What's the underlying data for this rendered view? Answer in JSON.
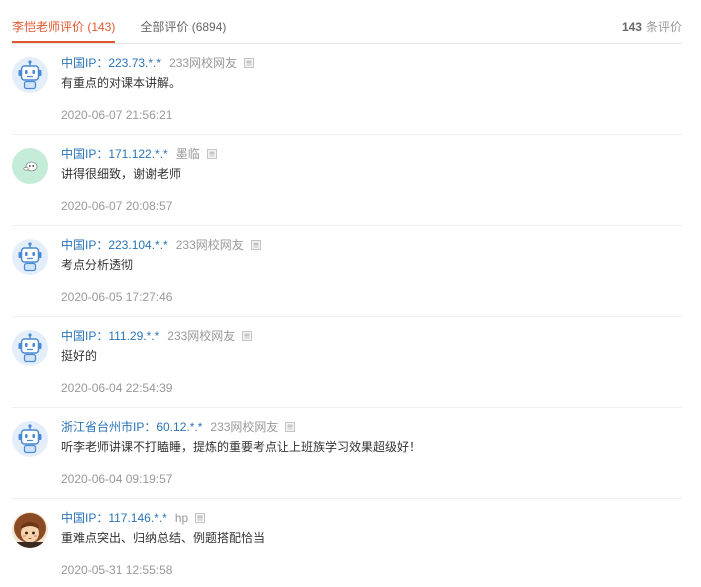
{
  "tabs": [
    {
      "label": "李恺老师评价 (143)",
      "active": true
    },
    {
      "label": "全部评价 (6894)",
      "active": false
    }
  ],
  "summary": {
    "count": "143",
    "label": "条评价"
  },
  "colors": {
    "accent": "#e4572e",
    "link": "#2a74b8",
    "text": "#333333",
    "secondary": "#666666",
    "muted": "#999999",
    "divider": "#eeeeee"
  },
  "reviews": [
    {
      "avatar": "robot-avatar",
      "ip": "中国IP：223.73.*.*",
      "user": "233网校网友",
      "badge": "user-badge-icon",
      "text": "有重点的对课本讲解。",
      "time": "2020-06-07 21:56:21"
    },
    {
      "avatar": "mint-cartoon-avatar",
      "ip": "中国IP：171.122.*.*",
      "user": "墨临",
      "badge": "user-badge-icon",
      "text": "讲得很细致，谢谢老师",
      "time": "2020-06-07 20:08:57"
    },
    {
      "avatar": "robot-avatar",
      "ip": "中国IP：223.104.*.*",
      "user": "233网校网友",
      "badge": "user-badge-icon",
      "text": "考点分析透彻",
      "time": "2020-06-05 17:27:46"
    },
    {
      "avatar": "robot-avatar",
      "ip": "中国IP：111.29.*.*",
      "user": "233网校网友",
      "badge": "user-badge-icon",
      "text": "挺好的",
      "time": "2020-06-04 22:54:39"
    },
    {
      "avatar": "robot-avatar",
      "ip": "浙江省台州市IP：60.12.*.*",
      "user": "233网校网友",
      "badge": "user-badge-icon",
      "text": "听李老师讲课不打瞌睡，提炼的重要考点让上班族学习效果超级好！",
      "time": "2020-06-04 09:19:57"
    },
    {
      "avatar": "cartoon-girl-avatar",
      "ip": "中国IP：117.146.*.*",
      "user": "hp",
      "badge": "user-badge-icon",
      "text": "重难点突出、归纳总结、例题搭配恰当",
      "time": "2020-05-31 12:55:58"
    }
  ]
}
